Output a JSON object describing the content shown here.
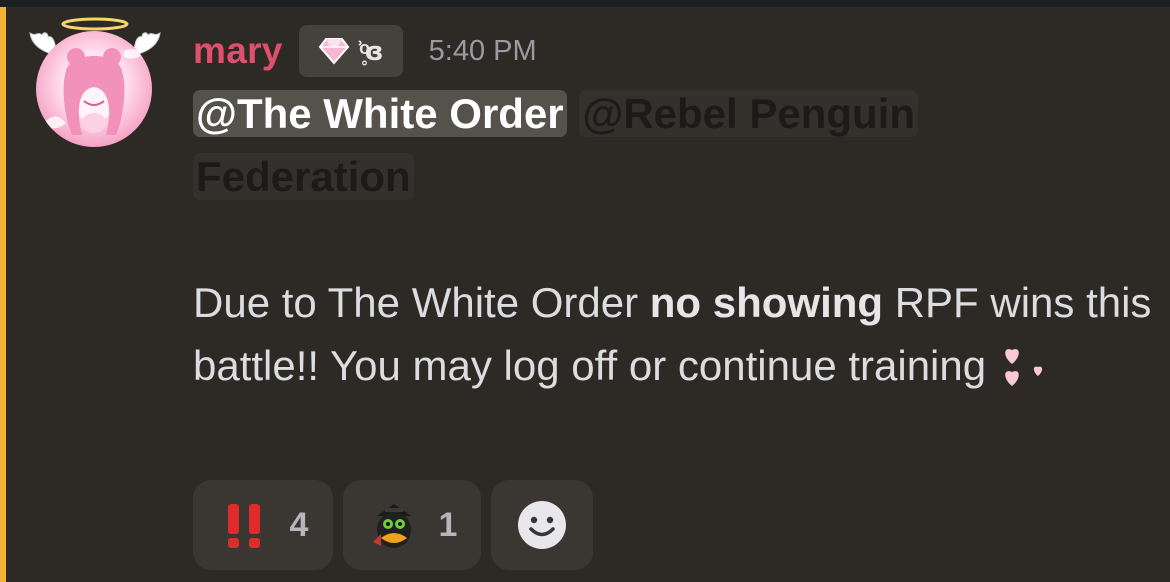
{
  "message": {
    "username": "mary",
    "username_color": "#e04f6c",
    "badge": {
      "icon": "diamond-icon",
      "text": "ʾ̥ͦɞ"
    },
    "timestamp": "5:40 PM",
    "mentions": [
      "@The White Order",
      "@Rebel Penguin Federation"
    ],
    "body": {
      "part1": "Due to The White Order ",
      "bold": "no showing",
      "part2": " RPF wins this battle!! You may log off or continue training "
    },
    "body_emoji": "pink-hearts-icon"
  },
  "reactions": [
    {
      "emoji": "double-exclamation-icon",
      "count": "4"
    },
    {
      "emoji": "penguin-icon",
      "count": "1"
    },
    {
      "emoji": "add-reaction-icon"
    }
  ],
  "colors": {
    "background": "#2d2a26",
    "accent_bar": "#f0b232",
    "mention_highlight": "#55514b"
  }
}
